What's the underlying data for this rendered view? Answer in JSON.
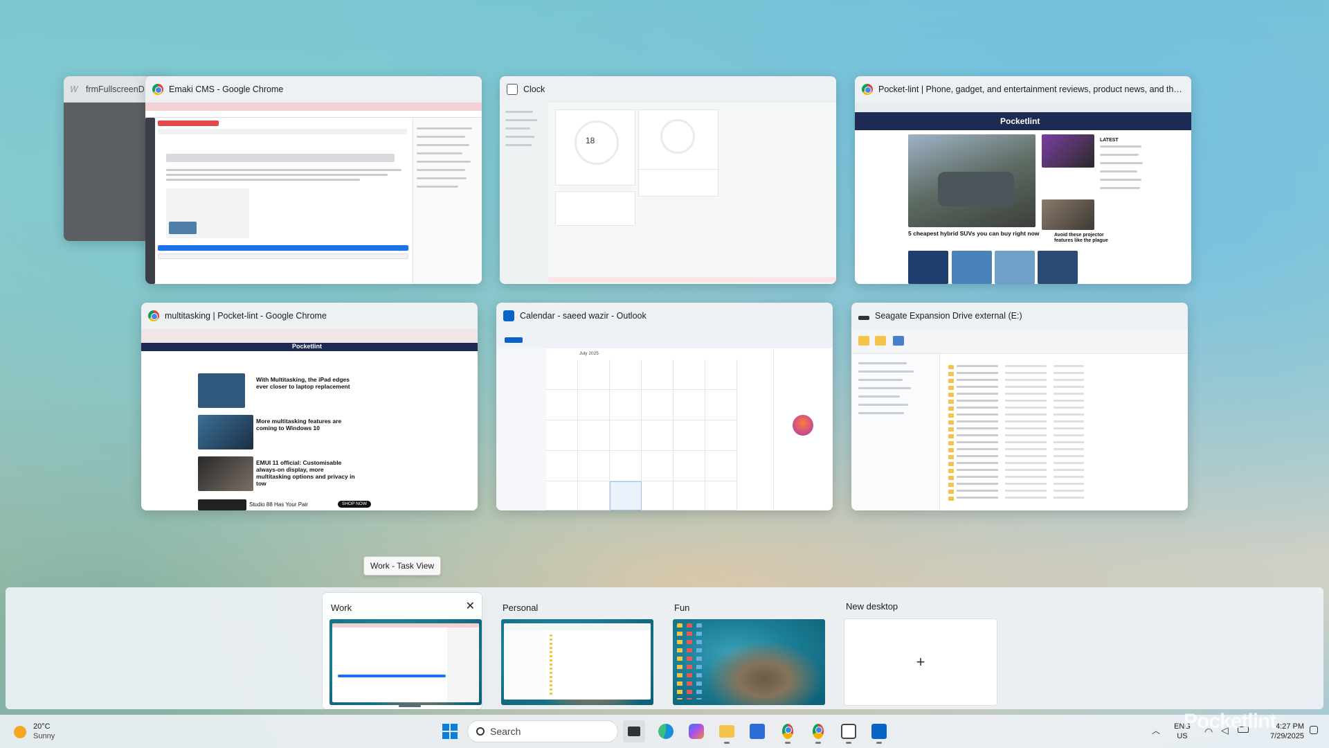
{
  "windows": {
    "ghost": {
      "title": "frmFullscreenD"
    },
    "emaki": {
      "title": "Emaki CMS - Google Chrome"
    },
    "clock": {
      "title": "Clock",
      "focus_minutes": "18"
    },
    "pocketlint": {
      "title": "Pocket-lint | Phone, gadget, and entertainment reviews, product news, and the...",
      "logo": "Pocketlint",
      "hero_headline": "5 cheapest hybrid SUVs you can buy right now",
      "side_headline": "Avoid these projector features like the plague",
      "latest": "LATEST"
    },
    "multitasking": {
      "title": "multitasking | Pocket-lint - Google Chrome",
      "logo": "Pocketlint",
      "articles": [
        "With Multitasking, the iPad edges ever closer to laptop replacement",
        "More multitasking features are coming to Windows 10",
        "EMUI 11 official: Customisable always-on display, more multitasking options and privacy in tow"
      ],
      "ad_text": "Studio 88 Has Your Pair",
      "ad_button": "SHOP NOW"
    },
    "outlook": {
      "title": "Calendar - saeed wazir - Outlook",
      "month": "July 2025"
    },
    "explorer": {
      "title": "Seagate Expansion Drive external (E:)"
    }
  },
  "tooltip": "Work - Task View",
  "desktops": [
    {
      "label": "Work",
      "close": "✕"
    },
    {
      "label": "Personal"
    },
    {
      "label": "Fun"
    },
    {
      "label": "New desktop",
      "plus": "+"
    }
  ],
  "taskbar": {
    "weather_temp": "20°C",
    "weather_desc": "Sunny",
    "search_placeholder": "Search",
    "lang_top": "ENG",
    "lang_bottom": "US",
    "time": "4:27 PM",
    "date": "7/29/2025",
    "icons": [
      "windows-start-icon",
      "search-icon",
      "task-view-icon",
      "edge-icon",
      "copilot-icon",
      "file-explorer-icon",
      "store-icon",
      "chrome-icon",
      "chrome-icon",
      "clock-icon",
      "outlook-icon"
    ]
  },
  "watermark": "Pocketlint",
  "colors": {
    "chrome_blue": "#4285f4",
    "pocketlint_navy": "#1d2a54",
    "outlook_blue": "#0a64c8",
    "accent": "#0067c0"
  }
}
